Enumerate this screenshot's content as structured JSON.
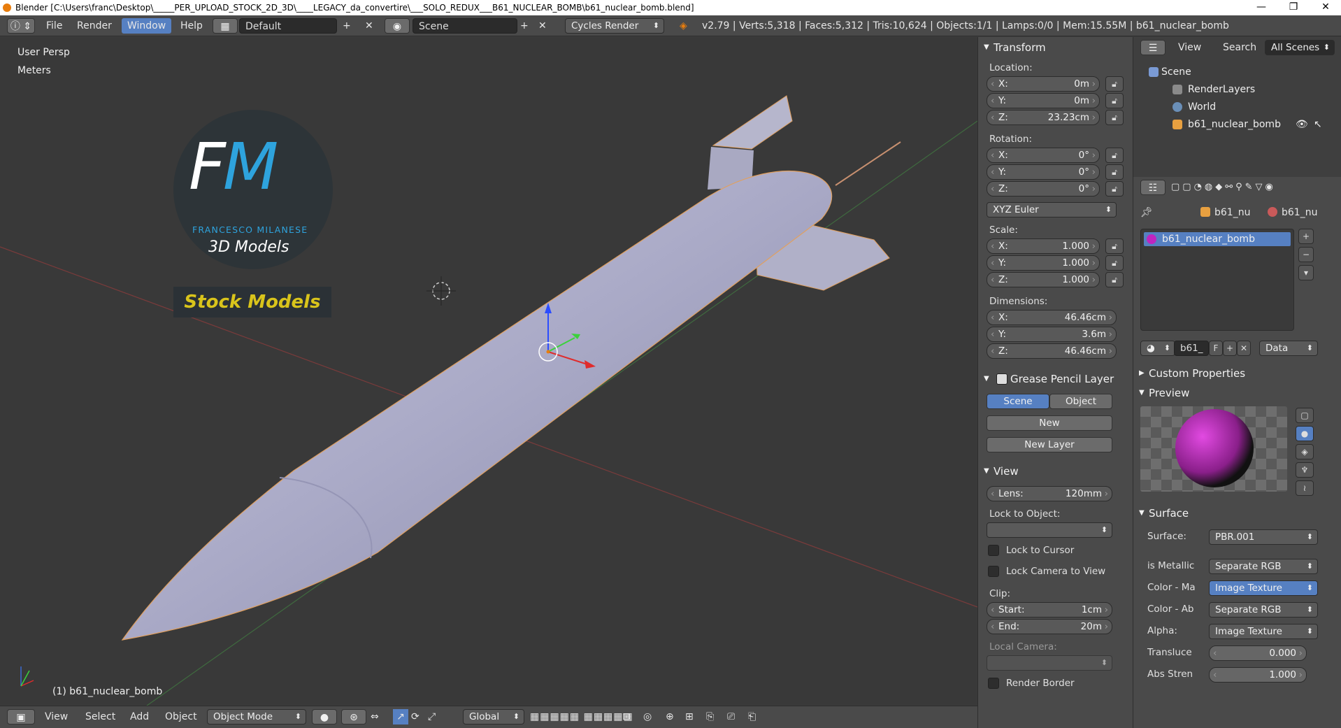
{
  "window": {
    "title": "Blender [C:\\Users\\franc\\Desktop\\_____PER_UPLOAD_STOCK_2D_3D\\____LEGACY_da_convertire\\___SOLO_REDUX___B61_NUCLEAR_BOMB\\b61_nuclear_bomb.blend]",
    "minimize": "—",
    "maximize": "❐",
    "close": "✕"
  },
  "menu": {
    "file": "File",
    "render": "Render",
    "window": "Window",
    "help": "Help"
  },
  "layout": {
    "screen": "Default",
    "scene": "Scene",
    "engine": "Cycles Render"
  },
  "stats": "v2.79 | Verts:5,318 | Faces:5,312 | Tris:10,624 | Objects:1/1 | Lamps:0/0 | Mem:15.55M | b61_nuclear_bomb",
  "viewport": {
    "persp": "User Persp",
    "units": "Meters",
    "object_label": "(1) b61_nuclear_bomb",
    "logo": {
      "fm_f": "F",
      "fm_m": "M",
      "sub": "FRANCESCO MILANESE",
      "models": "3D Models",
      "stock": "Stock Models"
    }
  },
  "bottombar": {
    "view": "View",
    "select": "Select",
    "add": "Add",
    "object": "Object",
    "mode": "Object Mode",
    "orientation": "Global"
  },
  "transform": {
    "title": "Transform",
    "location_label": "Location:",
    "loc": [
      {
        "k": "X:",
        "v": "0m"
      },
      {
        "k": "Y:",
        "v": "0m"
      },
      {
        "k": "Z:",
        "v": "23.23cm"
      }
    ],
    "rotation_label": "Rotation:",
    "rot": [
      {
        "k": "X:",
        "v": "0°"
      },
      {
        "k": "Y:",
        "v": "0°"
      },
      {
        "k": "Z:",
        "v": "0°"
      }
    ],
    "rotation_mode": "XYZ Euler",
    "scale_label": "Scale:",
    "scale": [
      {
        "k": "X:",
        "v": "1.000"
      },
      {
        "k": "Y:",
        "v": "1.000"
      },
      {
        "k": "Z:",
        "v": "1.000"
      }
    ],
    "dimensions_label": "Dimensions:",
    "dim": [
      {
        "k": "X:",
        "v": "46.46cm"
      },
      {
        "k": "Y:",
        "v": "3.6m"
      },
      {
        "k": "Z:",
        "v": "46.46cm"
      }
    ]
  },
  "grease": {
    "title": "Grease Pencil Layer",
    "scene": "Scene",
    "object": "Object",
    "new": "New",
    "new_layer": "New Layer"
  },
  "view": {
    "title": "View",
    "lens_k": "Lens:",
    "lens_v": "120mm",
    "lock_object": "Lock to Object:",
    "lock_cursor": "Lock to Cursor",
    "lock_camera": "Lock Camera to View",
    "clip": "Clip:",
    "start_k": "Start:",
    "start_v": "1cm",
    "end_k": "End:",
    "end_v": "20m",
    "local_camera": "Local Camera:",
    "render_border": "Render Border"
  },
  "outliner": {
    "view": "View",
    "search": "Search",
    "all_scenes": "All Scenes",
    "items": [
      "Scene",
      "RenderLayers",
      "World",
      "b61_nuclear_bomb"
    ]
  },
  "material": {
    "crumb1": "b61_nu",
    "crumb2": "b61_nu",
    "slot": "b61_nuclear_bomb",
    "mat_name": "b61_",
    "f": "F",
    "data": "Data",
    "custom_props": "Custom Properties",
    "preview": "Preview",
    "surface_title": "Surface",
    "rows": [
      {
        "k": "Surface:",
        "v": "PBR.001"
      },
      {
        "k": "is Metallic",
        "v": "Separate RGB"
      },
      {
        "k": "Color - Ma",
        "v": "Image Texture"
      },
      {
        "k": "Color - Ab",
        "v": "Separate RGB"
      },
      {
        "k": "Alpha:",
        "v": "Image Texture"
      }
    ],
    "transl_k": "Translucе",
    "transl_v": "0.000",
    "abs_k": "Abs Stren",
    "abs_v": "1.000"
  },
  "colors": {
    "accent": "#5680c2",
    "bg": "#393939",
    "panel": "#4a4a4a"
  }
}
